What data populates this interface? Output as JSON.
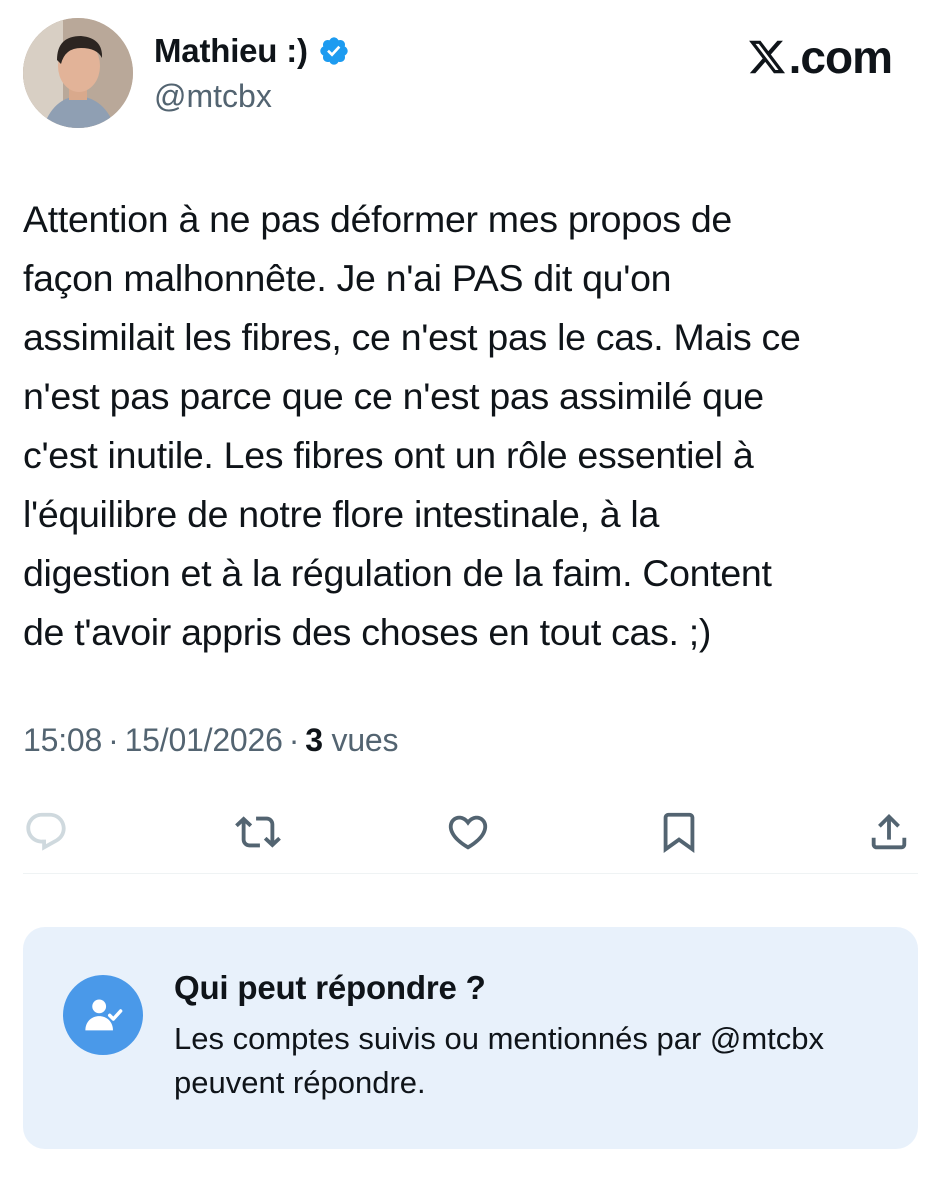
{
  "author": {
    "display_name": "Mathieu :)",
    "handle": "@mtcbx",
    "verified": true
  },
  "site_logo": {
    "icon": "x-logo-icon",
    "text": ".com"
  },
  "tweet": {
    "text": "Attention à ne pas déformer mes propos de\nfaçon malhonnête. Je n'ai PAS dit qu'on\nassimilait les fibres, ce n'est pas le cas. Mais ce\nn'est pas parce que ce n'est pas assimilé que\nc'est inutile. Les fibres ont un rôle essentiel à\nl'équilibre de notre flore intestinale, à la\ndigestion et à la régulation de la faim. Content\nde t'avoir appris des choses en tout cas. ;)",
    "time": "15:08",
    "date": "15/01/2026",
    "separator": "·",
    "views_count": "3",
    "views_label": "vues"
  },
  "actions": [
    {
      "name": "reply",
      "icon": "reply-icon"
    },
    {
      "name": "retweet",
      "icon": "retweet-icon"
    },
    {
      "name": "like",
      "icon": "heart-icon"
    },
    {
      "name": "bookmark",
      "icon": "bookmark-icon"
    },
    {
      "name": "share",
      "icon": "share-icon"
    }
  ],
  "reply_restriction": {
    "icon": "person-check-icon",
    "title": "Qui peut répondre ?",
    "description": "Les comptes suivis ou mentionnés par @mtcbx peuvent répondre."
  },
  "colors": {
    "verified_blue": "#1d9bf0",
    "muted_text": "#536471",
    "reply_box_bg": "#e8f1fb",
    "reply_icon_bg": "#4a99e9"
  }
}
